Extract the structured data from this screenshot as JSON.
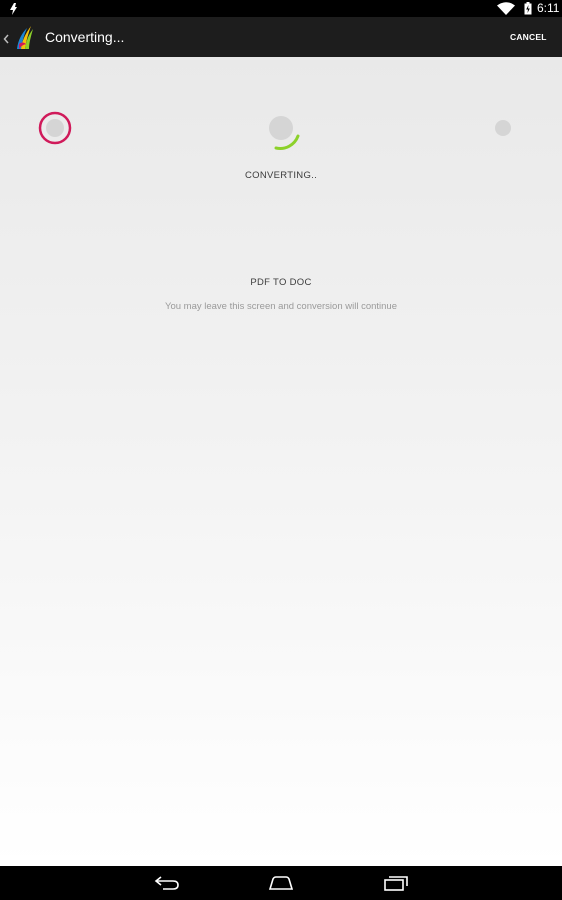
{
  "status_bar": {
    "time": "6:11",
    "icons": [
      "notification-icon",
      "wifi-icon",
      "battery-charging-icon"
    ]
  },
  "action_bar": {
    "title": "Converting...",
    "cancel_label": "CANCEL",
    "icons": [
      "chevron-left-icon",
      "app-logo-icon"
    ]
  },
  "conversion": {
    "status": "CONVERTING..",
    "type": "PDF TO DOC",
    "info": "You may leave this screen and conversion will continue"
  },
  "colors": {
    "source_ring": "#d01a5a",
    "spinner_arc": "#8cd12a",
    "step_dot": "#d5d5d5"
  },
  "nav_bar": {
    "icons": [
      "back-icon",
      "home-icon",
      "recents-icon"
    ]
  }
}
